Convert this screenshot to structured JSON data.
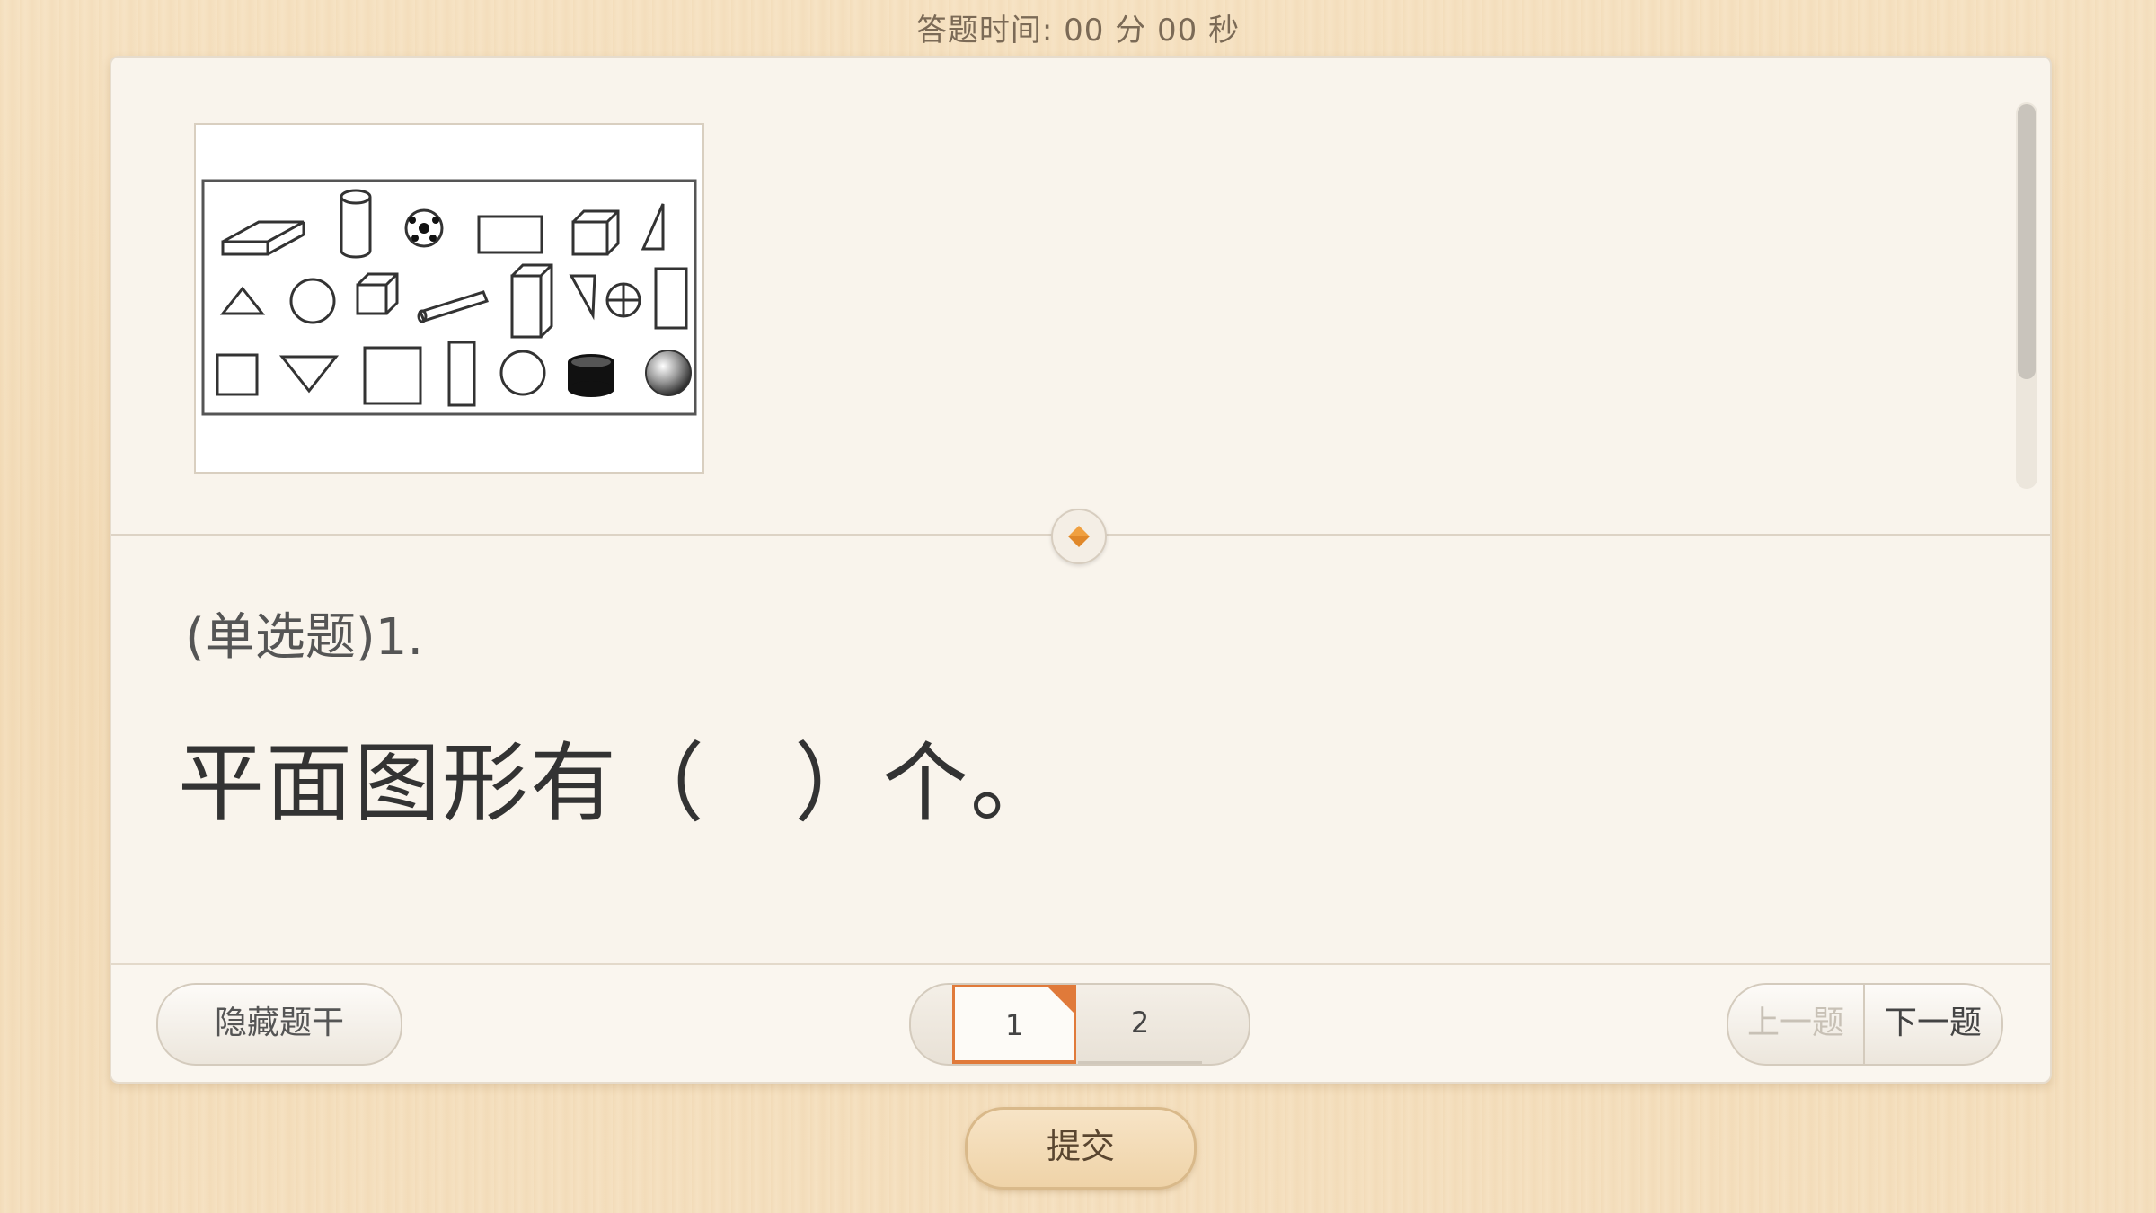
{
  "header": {
    "timer_label": "答题时间:",
    "timer_minutes": "00",
    "minutes_unit": "分",
    "timer_seconds": "00",
    "seconds_unit": "秒"
  },
  "question": {
    "type_label": "(单选题)1.",
    "text": "平面图形有（　）个。",
    "figure_icon": "shapes-illustration"
  },
  "footer": {
    "hide_stem_label": "隐藏题干",
    "pages": [
      {
        "label": "1",
        "current": true,
        "flagged": true
      },
      {
        "label": "2",
        "current": false,
        "flagged": false
      }
    ],
    "prev_label": "上一题",
    "next_label": "下一题"
  },
  "submit_label": "提交",
  "colors": {
    "accent": "#e07a3a",
    "card_bg": "#f9f4ec",
    "wood_bg": "#f4ddb9"
  }
}
